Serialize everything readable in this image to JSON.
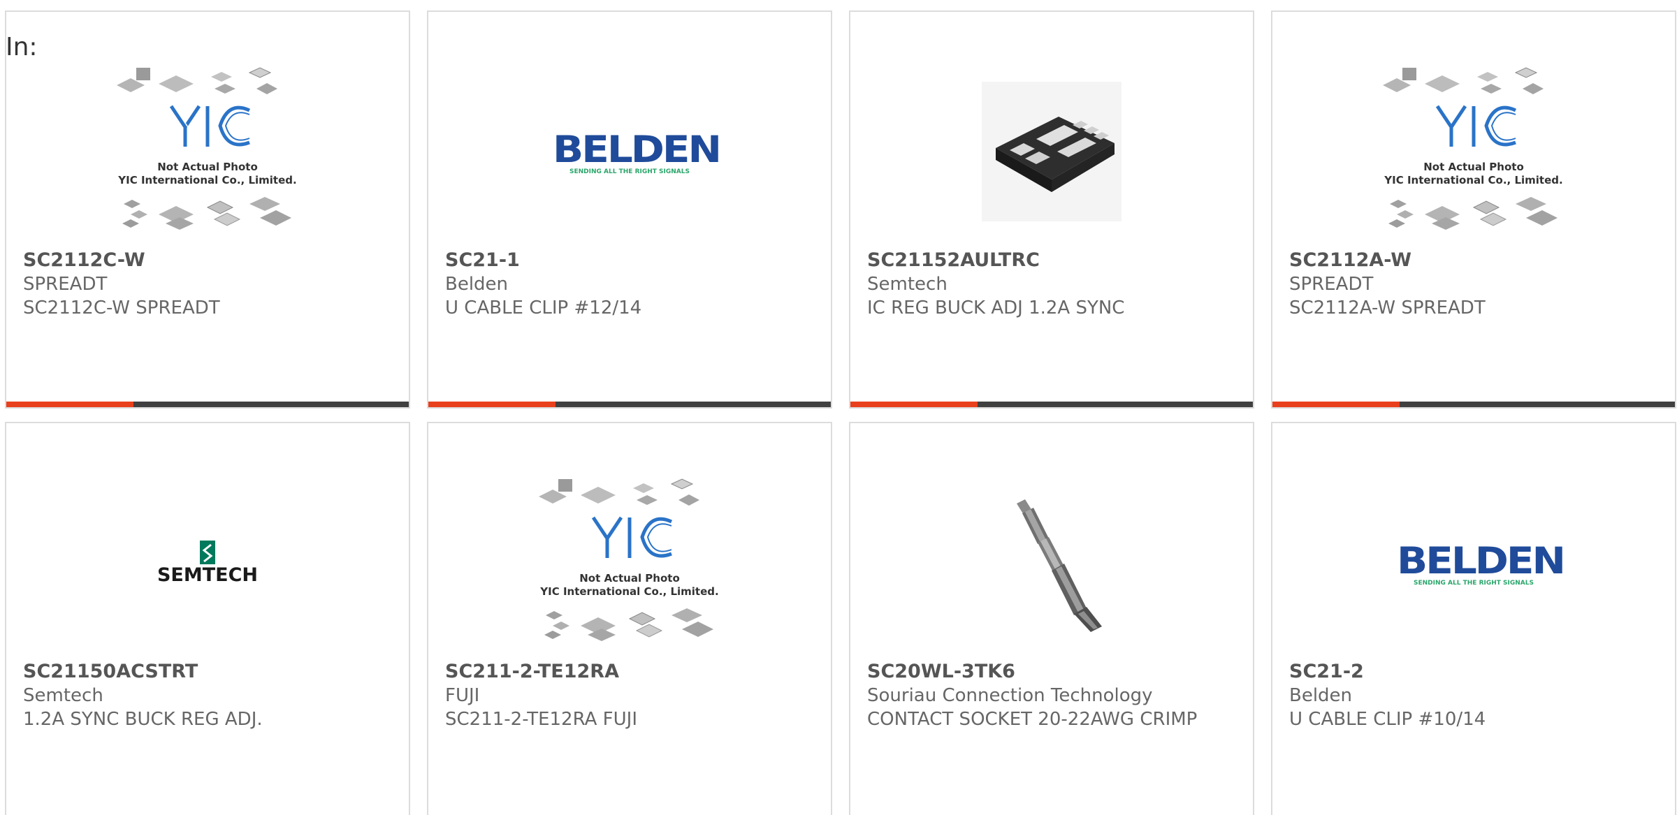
{
  "filter": {
    "label": "In:"
  },
  "theme": {
    "accent": "#e8401c",
    "bar_dark": "#404040",
    "card_border": "#dcdcdc",
    "belden_blue": "#1f4b9a",
    "belden_green": "#2aa66b",
    "yic_blue": "#2a73c8",
    "semtech_green": "#007a5c"
  },
  "placeholder": {
    "line1": "Not Actual Photo",
    "line2": "YIC International Co., Limited."
  },
  "logos": {
    "belden_name": "BELDEN",
    "belden_tagline": "SENDING ALL THE RIGHT SIGNALS",
    "semtech_name": "SEMTECH"
  },
  "products": [
    {
      "part": "SC2112C-W",
      "manufacturer": "SPREADT",
      "description": "SC2112C-W SPREADT",
      "image": "yic-placeholder"
    },
    {
      "part": "SC21-1",
      "manufacturer": "Belden",
      "description": "U CABLE CLIP #12/14",
      "image": "belden-logo"
    },
    {
      "part": "SC21152AULTRC",
      "manufacturer": "Semtech",
      "description": "IC REG BUCK ADJ 1.2A SYNC",
      "image": "ic-package-photo"
    },
    {
      "part": "SC2112A-W",
      "manufacturer": "SPREADT",
      "description": "SC2112A-W SPREADT",
      "image": "yic-placeholder"
    },
    {
      "part": "SC21150ACSTRT",
      "manufacturer": "Semtech",
      "description": "1.2A SYNC BUCK REG ADJ.",
      "image": "semtech-logo"
    },
    {
      "part": "SC211-2-TE12RA",
      "manufacturer": "FUJI",
      "description": "SC211-2-TE12RA FUJI",
      "image": "yic-placeholder"
    },
    {
      "part": "SC20WL-3TK6",
      "manufacturer": "Souriau Connection Technology",
      "description": "CONTACT SOCKET 20-22AWG CRIMP",
      "image": "crimp-contact-photo"
    },
    {
      "part": "SC21-2",
      "manufacturer": "Belden",
      "description": "U CABLE CLIP #10/14",
      "image": "belden-logo"
    }
  ]
}
